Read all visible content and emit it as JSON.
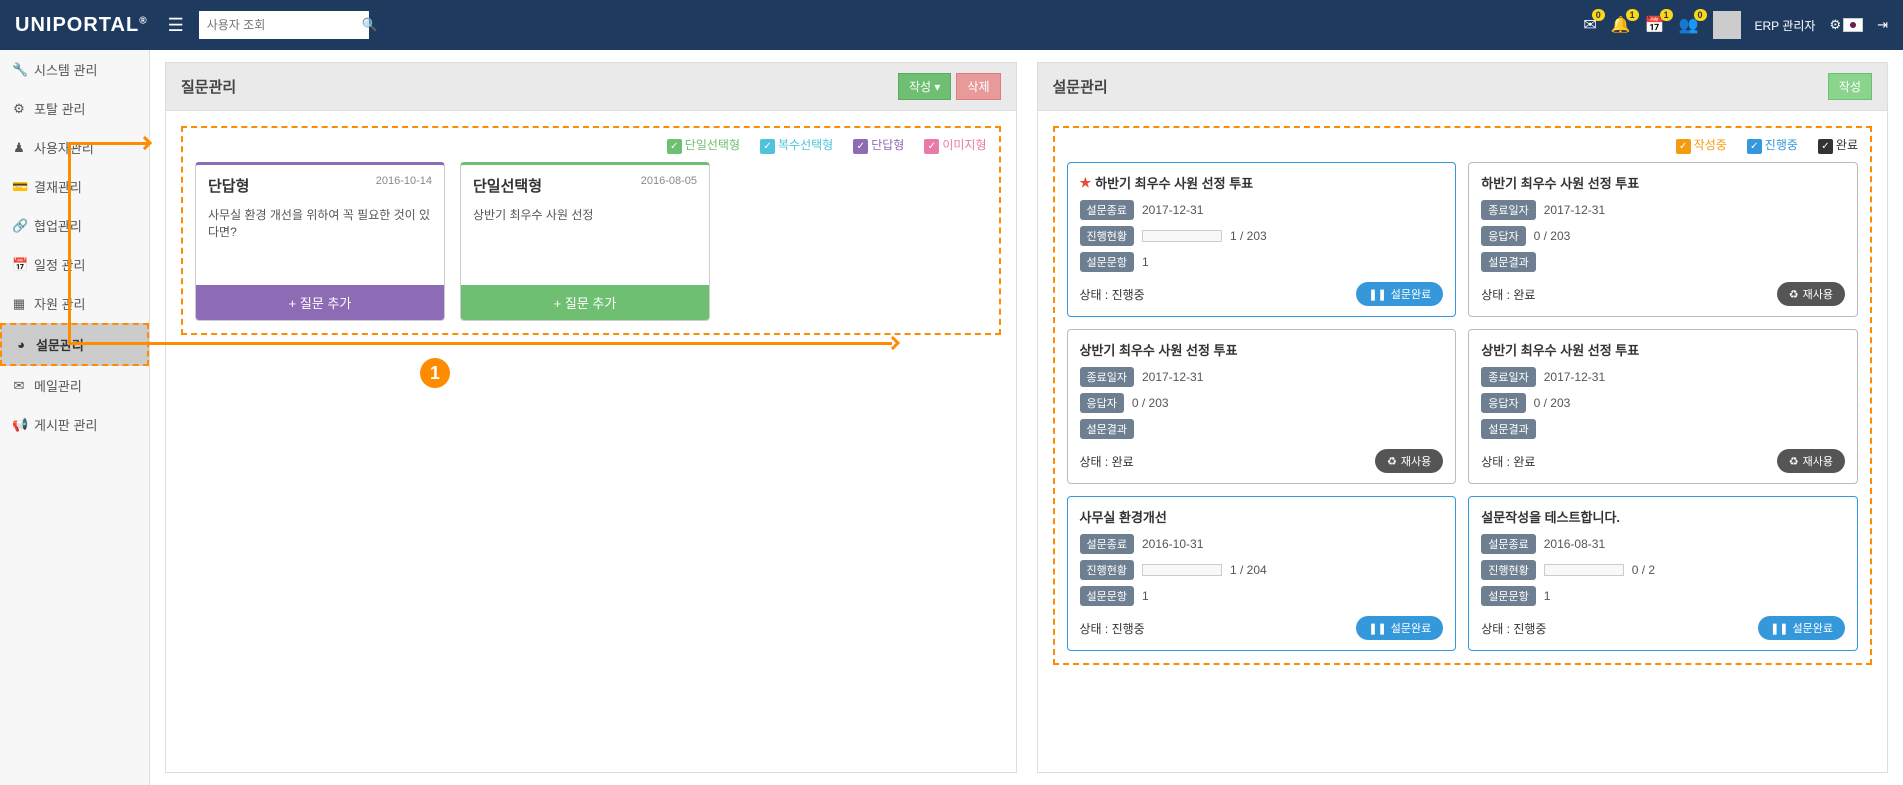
{
  "header": {
    "logo": "UNIPORTAL",
    "search_placeholder": "사용자 조회",
    "notif": {
      "mail": "0",
      "bell": "1",
      "cal": "1",
      "user": "0"
    },
    "user_name": "ERP 관리자"
  },
  "sidebar": {
    "items": [
      {
        "icon": "wrench",
        "label": "시스템 관리"
      },
      {
        "icon": "cogs",
        "label": "포탈 관리"
      },
      {
        "icon": "user",
        "label": "사용자관리"
      },
      {
        "icon": "card",
        "label": "결재관리"
      },
      {
        "icon": "link",
        "label": "협업관리"
      },
      {
        "icon": "calendar",
        "label": "일정 관리"
      },
      {
        "icon": "box",
        "label": "자원 관리"
      },
      {
        "icon": "pie",
        "label": "설문관리"
      },
      {
        "icon": "envelope",
        "label": "메일관리"
      },
      {
        "icon": "bullhorn",
        "label": "게시판 관리"
      }
    ]
  },
  "left_panel": {
    "title": "질문관리",
    "create_btn": "작성",
    "delete_btn": "삭제",
    "legend": [
      {
        "color": "green",
        "label": "단일선택형",
        "lcls": "lgnd-green"
      },
      {
        "color": "blue",
        "label": "복수선택형",
        "lcls": "lgnd-blue"
      },
      {
        "color": "purple",
        "label": "단답형",
        "lcls": "lgnd-purple"
      },
      {
        "color": "pink",
        "label": "이미지형",
        "lcls": "lgnd-pink"
      }
    ],
    "cards": [
      {
        "cls": "c-purple",
        "title": "단답형",
        "date": "2016-10-14",
        "body": "사무실 환경 개선을 위하여 꼭 필요한 것이 있다면?",
        "foot": "+ 질문 추가"
      },
      {
        "cls": "c-green",
        "title": "단일선택형",
        "date": "2016-08-05",
        "body": "상반기 최우수 사원 선정",
        "foot": "+ 질문 추가"
      }
    ]
  },
  "right_panel": {
    "title": "설문관리",
    "create_btn": "작성",
    "legend": [
      {
        "color": "orange",
        "label": "작성중",
        "lcls": "lgnd-orange"
      },
      {
        "color": "lblue",
        "label": "진행중",
        "lcls": "lgnd-lblue"
      },
      {
        "color": "dark",
        "label": "완료",
        "lcls": ""
      }
    ],
    "labels": {
      "end_date": "설문종료",
      "close_date": "종료일자",
      "progress": "진행현황",
      "responder": "응답자",
      "count": "설문문항",
      "result": "설문결과",
      "status_prefix": "상태 : ",
      "act_complete": "설문완료",
      "act_reuse": "재사용"
    },
    "cards": [
      {
        "title": "하반기 최우수 사원 선정 투표",
        "star": true,
        "cls": "",
        "rows": [
          [
            "end_date",
            "2017-12-31"
          ],
          [
            "progress",
            "1 / 203",
            "bar"
          ],
          [
            "count",
            "1"
          ]
        ],
        "status": "진행중",
        "action": "complete"
      },
      {
        "title": "하반기 최우수 사원 선정 투표",
        "star": false,
        "cls": "gray",
        "rows": [
          [
            "close_date",
            "2017-12-31"
          ],
          [
            "responder",
            "0 / 203"
          ],
          [
            "result",
            ""
          ]
        ],
        "status": "완료",
        "action": "reuse"
      },
      {
        "title": "상반기 최우수 사원 선정 투표",
        "star": false,
        "cls": "gray",
        "rows": [
          [
            "close_date",
            "2017-12-31"
          ],
          [
            "responder",
            "0 / 203"
          ],
          [
            "result",
            ""
          ]
        ],
        "status": "완료",
        "action": "reuse"
      },
      {
        "title": "상반기 최우수 사원 선정 투표",
        "star": false,
        "cls": "gray",
        "rows": [
          [
            "close_date",
            "2017-12-31"
          ],
          [
            "responder",
            "0 / 203"
          ],
          [
            "result",
            ""
          ]
        ],
        "status": "완료",
        "action": "reuse"
      },
      {
        "title": "사무실 환경개선",
        "star": false,
        "cls": "",
        "rows": [
          [
            "end_date",
            "2016-10-31"
          ],
          [
            "progress",
            "1 / 204",
            "bar"
          ],
          [
            "count",
            "1"
          ]
        ],
        "status": "진행중",
        "action": "complete"
      },
      {
        "title": "설문작성을 테스트합니다.",
        "star": false,
        "cls": "",
        "rows": [
          [
            "end_date",
            "2016-08-31"
          ],
          [
            "progress",
            "0 / 2",
            "bar"
          ],
          [
            "count",
            "1"
          ]
        ],
        "status": "진행중",
        "action": "complete"
      }
    ]
  },
  "annotation": {
    "number": "1"
  }
}
